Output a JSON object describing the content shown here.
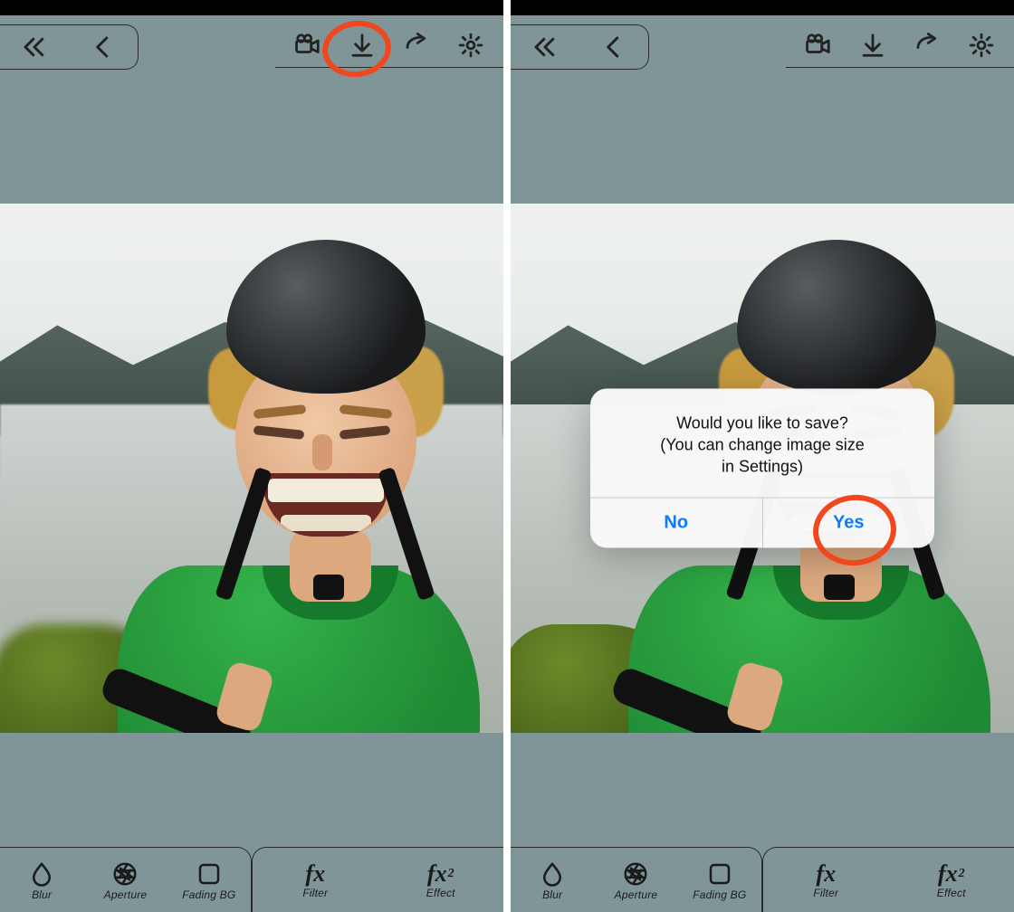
{
  "icons": {
    "back_all": "double-chevron-left-icon",
    "back": "chevron-left-icon",
    "video": "video-camera-icon",
    "download": "download-icon",
    "share": "share-arrow-icon",
    "settings": "gear-icon",
    "blur": "droplet-icon",
    "aperture": "aperture-icon",
    "fading": "square-icon"
  },
  "toolbar": {
    "nav": [
      "back_all",
      "back"
    ],
    "actions": [
      "video",
      "download",
      "share",
      "settings"
    ]
  },
  "bottom": {
    "left": [
      {
        "id": "blur",
        "label": "Blur",
        "icon": "droplet"
      },
      {
        "id": "aperture",
        "label": "Aperture",
        "icon": "aperture"
      },
      {
        "id": "fading",
        "label": "Fading BG",
        "icon": "square"
      }
    ],
    "right": [
      {
        "id": "filter",
        "label": "Filter",
        "fx": "fx"
      },
      {
        "id": "effect",
        "label": "Effect",
        "fx": "fx2"
      }
    ]
  },
  "dialog": {
    "line1": "Would you like to save?",
    "line2": "(You can change image size",
    "line3": "in Settings)",
    "no": "No",
    "yes": "Yes"
  },
  "annotations": {
    "left_target": "download-button",
    "right_target": "dialog-yes-button"
  },
  "colors": {
    "app_bg": "#7f9597",
    "ink": "#222222",
    "annotation": "#f0471f",
    "ios_blue": "#0a7bff"
  }
}
